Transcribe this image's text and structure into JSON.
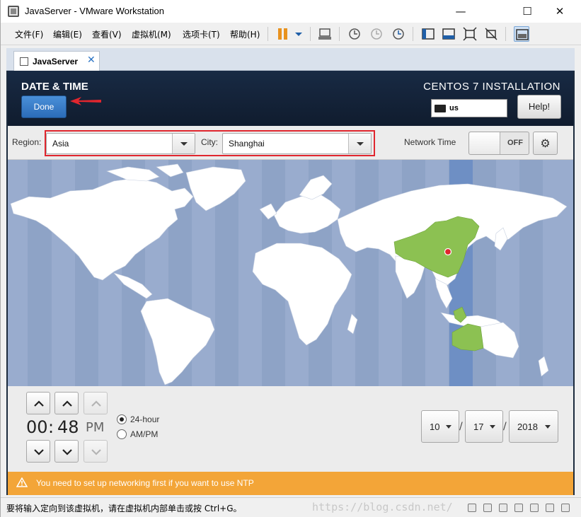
{
  "window": {
    "title": "JavaServer - VMware Workstation",
    "minimize": "—",
    "maximize": "☐",
    "close": "✕"
  },
  "menu": {
    "items": [
      "文件(F)",
      "编辑(E)",
      "查看(V)",
      "虚拟机(M)",
      "选项卡(T)",
      "帮助(H)"
    ]
  },
  "tab": {
    "label": "JavaServer",
    "close": "✕"
  },
  "installer": {
    "page_title": "DATE & TIME",
    "install_title": "CENTOS 7 INSTALLATION",
    "done_label": "Done",
    "help_label": "Help!",
    "keyboard_layout": "us"
  },
  "selectors": {
    "region_label": "Region:",
    "region_value": "Asia",
    "city_label": "City:",
    "city_value": "Shanghai",
    "network_time_label": "Network Time",
    "network_time_state": "OFF"
  },
  "time": {
    "hours": "00",
    "separator": ":",
    "minutes": "48",
    "ampm": "PM",
    "format_24": "24-hour",
    "format_ampm": "AM/PM",
    "selected_format": "24-hour"
  },
  "date": {
    "month": "10",
    "day": "17",
    "year": "2018",
    "separator": "/"
  },
  "warning": {
    "text": "You need to set up networking first if you want to use NTP"
  },
  "statusbar": {
    "text": "要将输入定向到该虚拟机，请在虚拟机内部单击或按 Ctrl+G。",
    "watermark": "https://blog.csdn.net/"
  },
  "colors": {
    "header_bg": "#14233a",
    "done_button": "#3a7fcc",
    "warning_bg": "#f3a538",
    "selected_region": "#8cc152",
    "ocean": "#8ea3c6",
    "highlight_box": "#e0262e"
  }
}
